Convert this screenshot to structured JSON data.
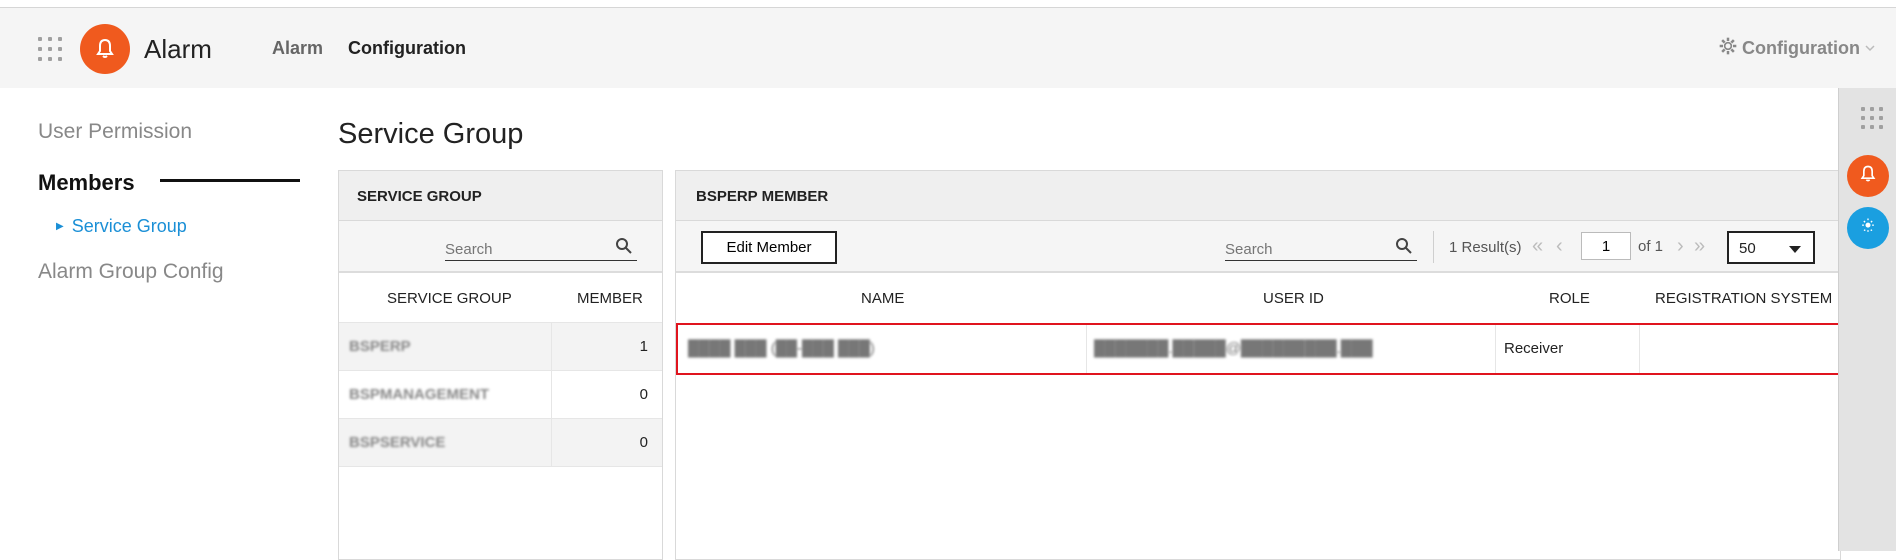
{
  "app": {
    "title": "Alarm",
    "accent": "#f05a1e",
    "link_color": "#1a8fd6",
    "highlight": "#e0141e"
  },
  "topnav": {
    "items": [
      "Alarm",
      "Configuration"
    ],
    "active": "Configuration"
  },
  "config_menu": {
    "label": "Configuration"
  },
  "sidebar": {
    "user_permission": "User Permission",
    "members": "Members",
    "service_group": "Service Group",
    "alarm_group_config": "Alarm Group Config"
  },
  "page": {
    "title": "Service Group"
  },
  "service_group_panel": {
    "header": "SERVICE GROUP",
    "search_placeholder": "Search",
    "columns": [
      "SERVICE GROUP",
      "MEMBER"
    ],
    "rows": [
      {
        "name": "BSPERP",
        "member": "1"
      },
      {
        "name": "BSPMANAGEMENT",
        "member": "0"
      },
      {
        "name": "BSPSERVICE",
        "member": "0"
      }
    ]
  },
  "member_panel": {
    "header": "BSPERP MEMBER",
    "edit_button": "Edit Member",
    "search_placeholder": "Search",
    "results": "1 Result(s)",
    "page": "1",
    "of": "of 1",
    "per_page": "50",
    "columns": [
      "NAME",
      "USER ID",
      "ROLE",
      "REGISTRATION SYSTEM"
    ],
    "rows": [
      {
        "name": "████ ███ (██-███ ███)",
        "user_id": "███████.█████@█████████.███",
        "role": "Receiver",
        "registration_system": ""
      }
    ]
  },
  "icons": [
    "apps-grid-icon",
    "bell-icon",
    "gear-icon",
    "chevron-down-icon",
    "search-icon",
    "first-page-icon",
    "prev-page-icon",
    "next-page-icon",
    "last-page-icon",
    "weather-icon"
  ]
}
